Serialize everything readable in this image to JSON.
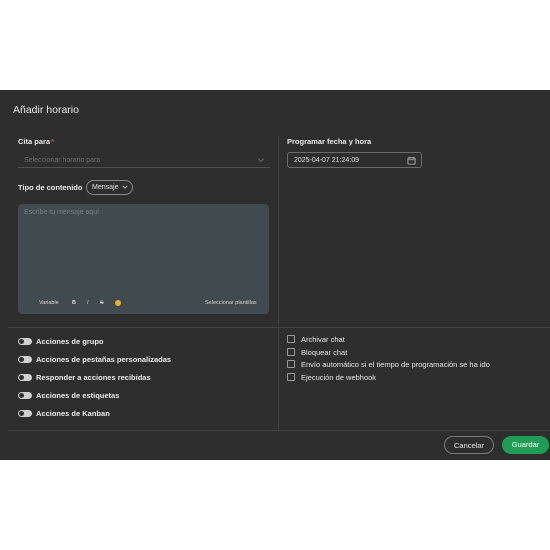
{
  "dialog": {
    "title": "Añadir horario"
  },
  "cita": {
    "label": "Cita para",
    "required_mark": "*",
    "placeholder": "Seleccionar horario para"
  },
  "content_type": {
    "label": "Tipo de contenido",
    "value": "Mensaje"
  },
  "editor": {
    "placeholder": "Escribe tu mensaje aquí",
    "toolbar": {
      "variable": "Variable",
      "bold": "B",
      "italic": "I",
      "strike": "S",
      "templates": "Seleccionar plantillas"
    }
  },
  "schedule": {
    "label": "Programar fecha y hora",
    "value": "2025-04-07 21:24:09"
  },
  "toggles": [
    {
      "label": "Acciones de grupo",
      "on": false
    },
    {
      "label": "Acciones de pestañas personalizadas",
      "on": false
    },
    {
      "label": "Responder a acciones recibidas",
      "on": false
    },
    {
      "label": "Acciones de estiquetas",
      "on": false
    },
    {
      "label": "Acciones de Kanban",
      "on": false
    }
  ],
  "checkboxes": [
    {
      "label": "Archivar chat",
      "checked": false
    },
    {
      "label": "Bloquear chat",
      "checked": false
    },
    {
      "label": "Envío automático si el tiempo de programación se ha ido",
      "checked": false
    },
    {
      "label": "Ejecución de webhook",
      "checked": false
    }
  ],
  "footer": {
    "cancel": "Cancelar",
    "save": "Guardar"
  },
  "colors": {
    "dialog_bg": "#2e2e2e",
    "editor_bg": "#414a4e",
    "primary": "#1f9d55",
    "required": "#d9534f"
  }
}
